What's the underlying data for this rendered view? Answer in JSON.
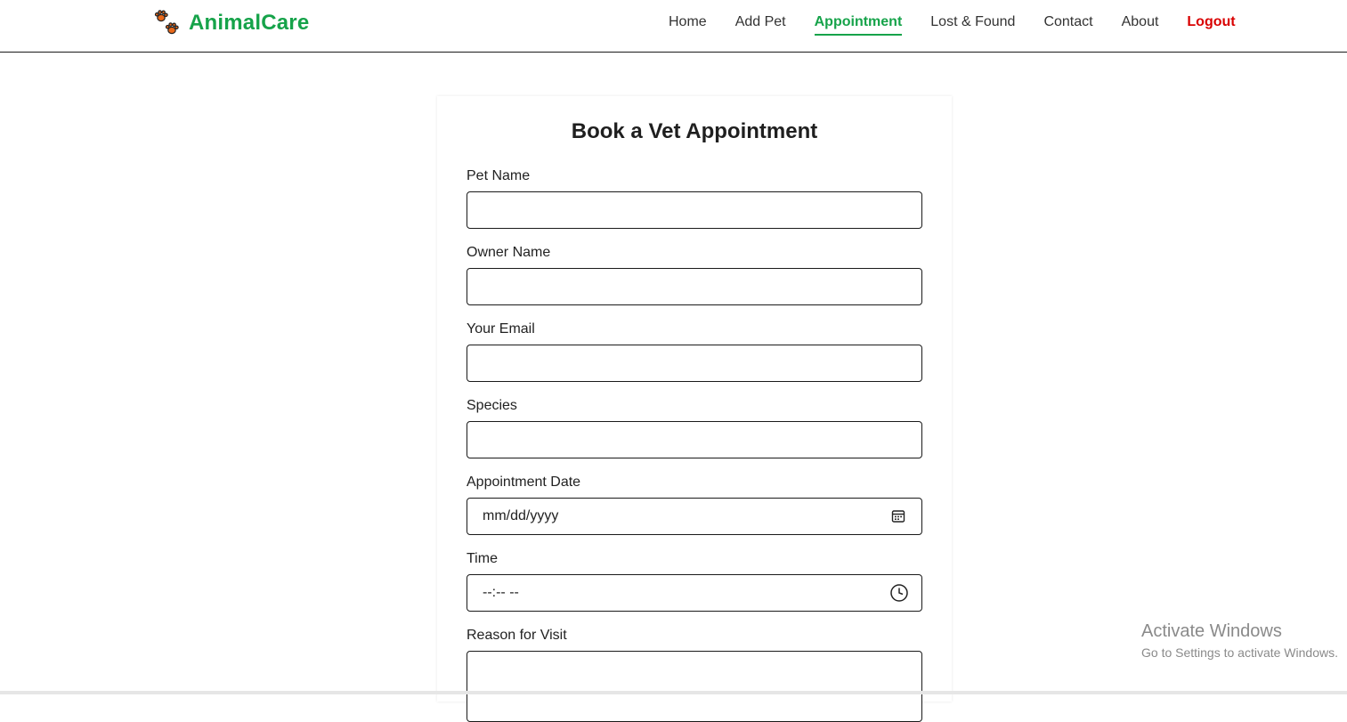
{
  "brand": {
    "name": "AnimalCare",
    "icon": "paw-prints-icon",
    "color": "#16a34a",
    "paw_color": "#e8681a"
  },
  "nav": {
    "items": [
      {
        "label": "Home"
      },
      {
        "label": "Add Pet"
      },
      {
        "label": "Appointment",
        "active": true
      },
      {
        "label": "Lost & Found"
      },
      {
        "label": "Contact"
      },
      {
        "label": "About"
      },
      {
        "label": "Logout",
        "color": "#d90000"
      }
    ]
  },
  "form": {
    "title": "Book a Vet Appointment",
    "fields": {
      "pet_name": {
        "label": "Pet Name",
        "value": ""
      },
      "owner_name": {
        "label": "Owner Name",
        "value": ""
      },
      "email": {
        "label": "Your Email",
        "value": ""
      },
      "species": {
        "label": "Species",
        "value": ""
      },
      "date": {
        "label": "Appointment Date",
        "placeholder": "mm/dd/yyyy",
        "icon": "calendar-icon"
      },
      "time": {
        "label": "Time",
        "placeholder": "--:-- --",
        "icon": "clock-icon"
      },
      "reason": {
        "label": "Reason for Visit",
        "value": ""
      }
    }
  },
  "os_watermark": {
    "line1": "Activate Windows",
    "line2": "Go to Settings to activate Windows."
  }
}
